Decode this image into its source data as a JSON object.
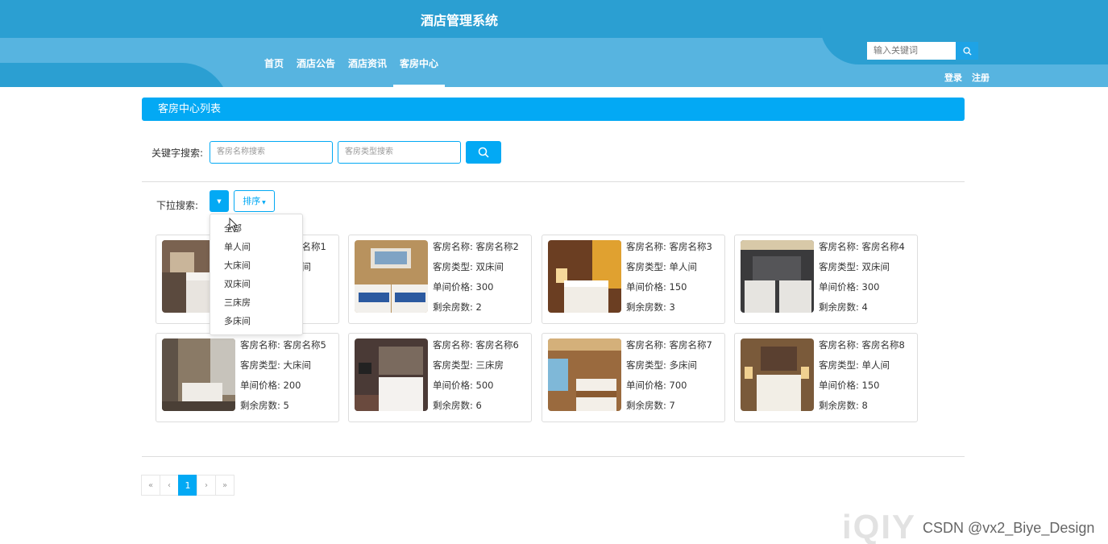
{
  "header": {
    "title": "酒店管理系统",
    "nav": [
      "首页",
      "酒店公告",
      "酒店资讯",
      "客房中心"
    ],
    "active_nav": "客房中心",
    "search_placeholder": "输入关键词",
    "login": "登录",
    "register": "注册"
  },
  "section_title": "客房中心列表",
  "keyword_search": {
    "label": "关键字搜索:",
    "name_placeholder": "客房名称搜索",
    "type_placeholder": "客房类型搜索"
  },
  "dropdown_search": {
    "label": "下拉搜索:",
    "sort_label": "排序",
    "options": [
      "全部",
      "单人间",
      "大床间",
      "双床间",
      "三床房",
      "多床间"
    ]
  },
  "room_field_labels": {
    "name": "客房名称:",
    "type": "客房类型:",
    "price": "单间价格:",
    "remaining": "剩余房数:"
  },
  "rooms": [
    {
      "name": "客房名称1",
      "type": "大床间",
      "price": "",
      "remaining": ""
    },
    {
      "name": "客房名称2",
      "type": "双床间",
      "price": "300",
      "remaining": "2"
    },
    {
      "name": "客房名称3",
      "type": "单人间",
      "price": "150",
      "remaining": "3"
    },
    {
      "name": "客房名称4",
      "type": "双床间",
      "price": "300",
      "remaining": "4"
    },
    {
      "name": "客房名称5",
      "type": "大床间",
      "price": "200",
      "remaining": "5"
    },
    {
      "name": "客房名称6",
      "type": "三床房",
      "price": "500",
      "remaining": "6"
    },
    {
      "name": "客房名称7",
      "type": "多床间",
      "price": "700",
      "remaining": "7"
    },
    {
      "name": "客房名称8",
      "type": "单人间",
      "price": "150",
      "remaining": "8"
    }
  ],
  "pagination": {
    "first": "«",
    "prev": "‹",
    "current": "1",
    "next": "›",
    "last": "»"
  },
  "watermark": {
    "logo_text": "iQIYI",
    "credit": "CSDN @vx2_Biye_Design"
  },
  "colors": {
    "header_dark": "#2b9fd2",
    "header_light": "#57b4e0",
    "accent": "#03a9f4"
  }
}
